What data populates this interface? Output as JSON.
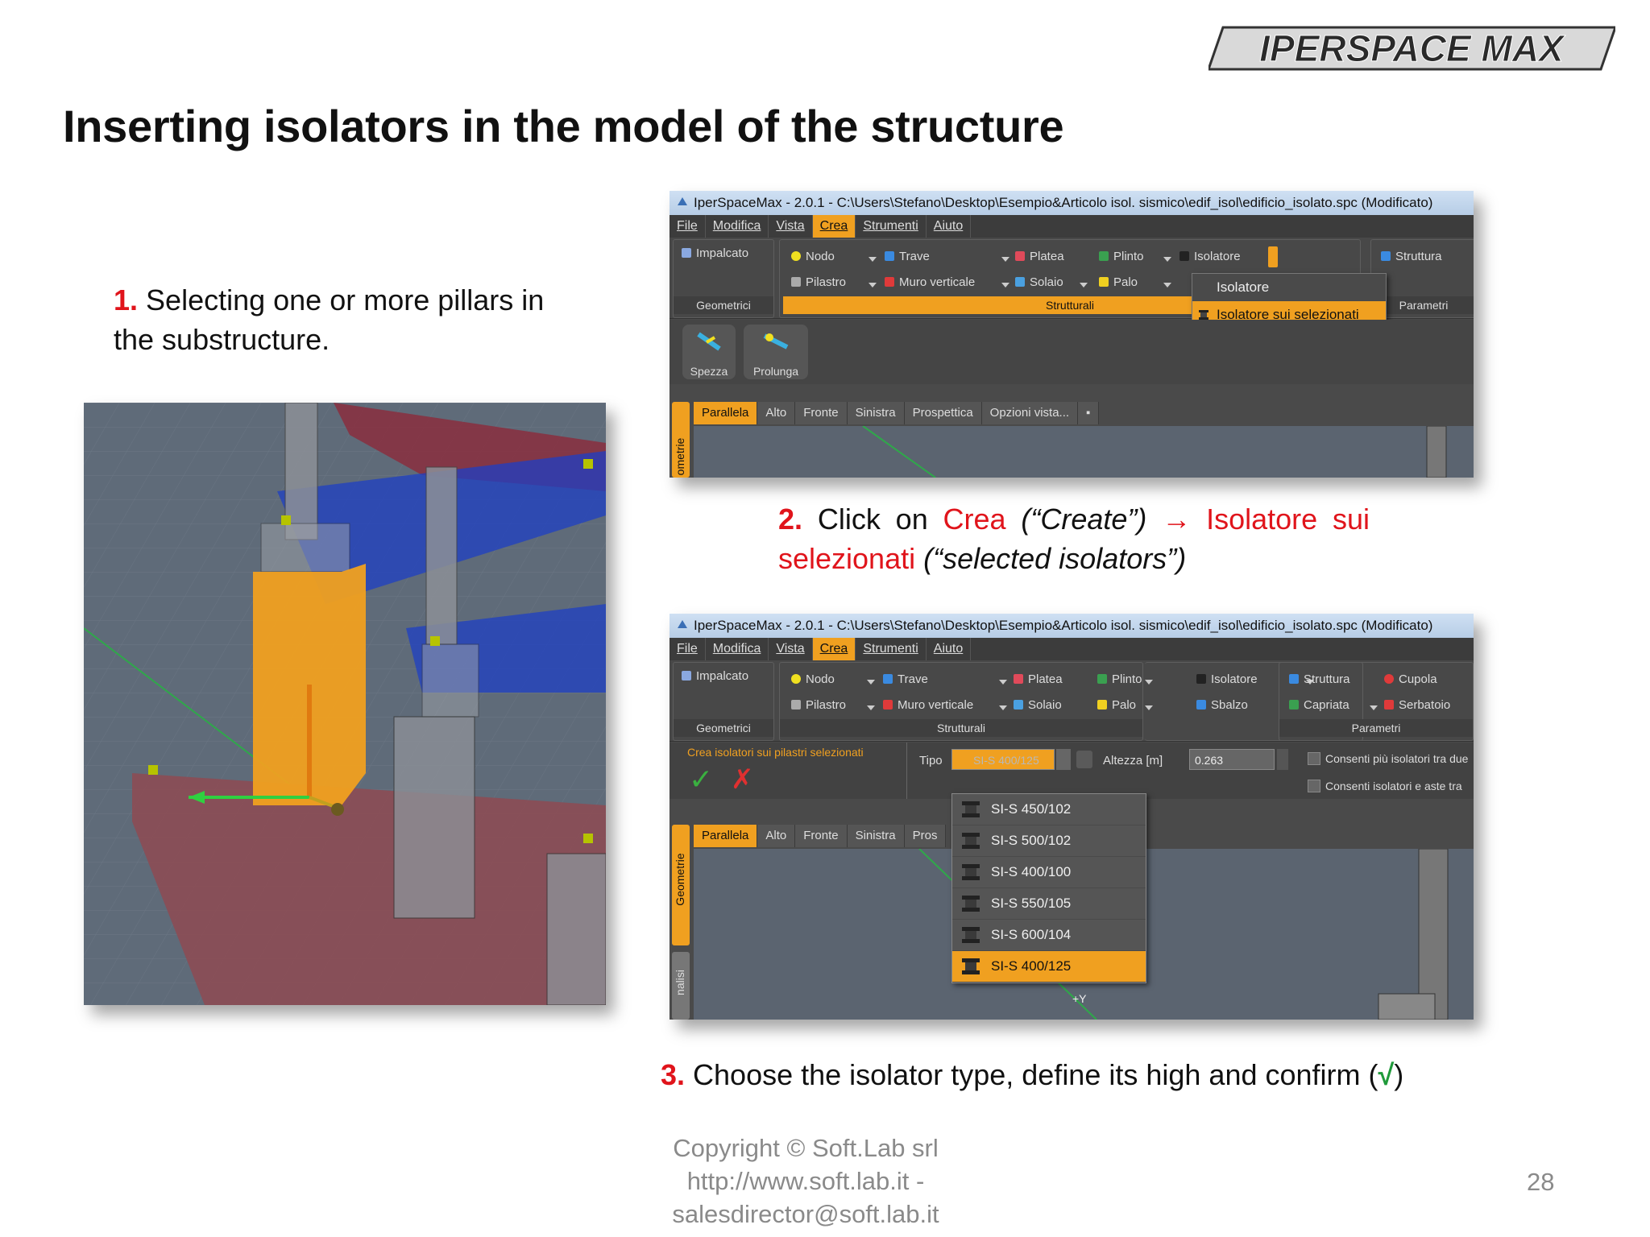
{
  "brand": {
    "logo_text": "IPERSPACE MAX"
  },
  "slide": {
    "title": "Inserting isolators in the model of the structure",
    "page_number": "28"
  },
  "steps": {
    "s1_num": "1.",
    "s1_text": " Selecting one or more pillars in the substructure.",
    "s2_num": "2.",
    "s2_a": " Click on ",
    "s2_crea": "Crea",
    "s2_b": " (“Create”) ",
    "s2_arrow": "→",
    "s2_iso": " Isolatore sui",
    "s2_sel": "selezionati",
    "s2_c": " (“selected isolators”)",
    "s3_num": "3.",
    "s3_text": " Choose the isolator type, define its high and confirm  (",
    "s3_check": "√",
    "s3_end": ")"
  },
  "footer": {
    "line1": "Copyright © Soft.Lab  srl",
    "line2": "http://www.soft.lab.it -",
    "line3": "salesdirector@soft.lab.it"
  },
  "app": {
    "window_title": "IperSpaceMax - 2.0.1 - C:\\Users\\Stefano\\Desktop\\Esempio&Articolo isol. sismico\\edif_isol\\edificio_isolato.spc (Modificato)",
    "menu": [
      "File",
      "Modifica",
      "Vista",
      "Crea",
      "Strumenti",
      "Aiuto"
    ],
    "ribbon": {
      "impalcato": "Impalcato",
      "geometrici": "Geometrici",
      "nodo": "Nodo",
      "pilastro": "Pilastro",
      "trave": "Trave",
      "muro": "Muro verticale",
      "platea": "Platea",
      "solaio": "Solaio",
      "plinto": "Plinto",
      "palo": "Palo",
      "isolatore": "Isolatore",
      "sbalzo": "Sbalzo",
      "strutturali": "Strutturali",
      "struttura": "Struttura",
      "capriata": "Capriata",
      "cupola": "Cupola",
      "serbatoio": "Serbatoio",
      "parametri": "Parametri"
    },
    "tools": {
      "spezza": "Spezza",
      "prolunga": "Prolunga"
    },
    "view_tabs": [
      "Parallela",
      "Alto",
      "Fronte",
      "Sinistra",
      "Prospettica"
    ],
    "view_tabs_short": [
      "Parallela",
      "Alto",
      "Fronte",
      "Sinistra",
      "Pros"
    ],
    "view_options": "Opzioni vista...",
    "side_tab_geometrie": "Geometrie",
    "side_tab_geometrie_cut": "ometrie",
    "side_tab_analisi": "nalisi",
    "popup": {
      "item1": "Isolatore",
      "item2": "Isolatore sui selezionati"
    },
    "panel": {
      "title": "Crea isolatori sui pilastri selezionati",
      "tipo_label": "Tipo",
      "tipo_value": "SI-S 400/125",
      "altezza_label": "Altezza [m]",
      "altezza_value": "0.263",
      "opt1": "Consenti più isolatori tra due",
      "opt2": "Consenti isolatori e aste tra"
    },
    "isolator_types": [
      "SI-S 450/102",
      "SI-S 500/102",
      "SI-S 400/100",
      "SI-S 550/105",
      "SI-S 600/104",
      "SI-S 400/125"
    ],
    "isolator_selected": "SI-S 400/125",
    "axis_label": "+Y"
  }
}
